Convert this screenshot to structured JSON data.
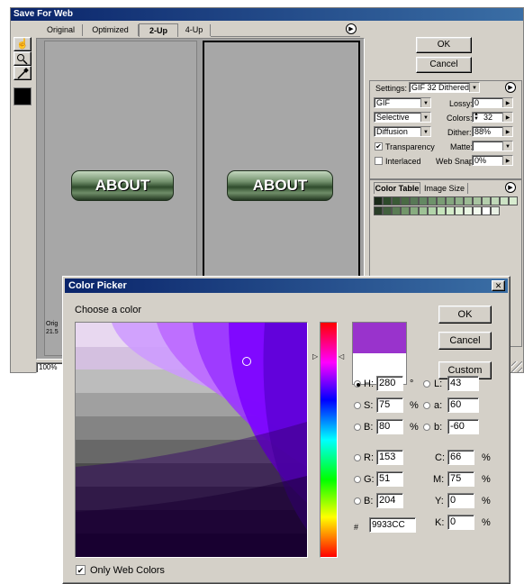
{
  "save_for_web": {
    "title": "Save For Web",
    "tabs": [
      "Original",
      "Optimized",
      "2-Up",
      "4-Up"
    ],
    "buttons": {
      "ok": "OK",
      "cancel": "Cancel"
    },
    "preview_text": "ABOUT",
    "info_line1": "Orig",
    "info_line2": "21.5",
    "zoom": "100%",
    "settings": {
      "label": "Settings:",
      "preset": "GIF 32 Dithered",
      "format": "GIF",
      "reduction": "Selective",
      "dither_algo": "Diffusion",
      "lossy_label": "Lossy:",
      "lossy": "0",
      "colors_label": "Colors:",
      "colors": "32",
      "dither_label": "Dither:",
      "dither": "88%",
      "matte_label": "Matte:",
      "transparency_label": "Transparency",
      "transparency_checked": true,
      "interlaced_label": "Interlaced",
      "interlaced_checked": false,
      "websnap_label": "Web Snap:",
      "websnap": "0%"
    },
    "panel_tabs": [
      "Color Table",
      "Image Size"
    ],
    "color_table": [
      "#1a2a18",
      "#2d4a2a",
      "#3a5a36",
      "#4a6a44",
      "#587856",
      "#648862",
      "#6e926a",
      "#7a9c74",
      "#84a67e",
      "#90b08a",
      "#9cba94",
      "#a8c4a0",
      "#b4ceac",
      "#c0d8b8",
      "#cce2c4",
      "#d8ecd0",
      "#2a3e28",
      "#42603e",
      "#5a7c54",
      "#72966a",
      "#88ac80",
      "#9ec296",
      "#b2d4aa",
      "#c6e4bc",
      "#d4ecca",
      "#e0f2d8",
      "#eaf6e4",
      "#f2faee",
      "#ffffff",
      "#e8f0e4"
    ]
  },
  "color_picker": {
    "title": "Color Picker",
    "prompt": "Choose a color",
    "buttons": {
      "ok": "OK",
      "cancel": "Cancel",
      "custom": "Custom"
    },
    "colors": {
      "new": "#9933cc",
      "original": "#ffffff"
    },
    "hsb": {
      "h_label": "H:",
      "h": "280",
      "h_unit": "°",
      "s_label": "S:",
      "s": "75",
      "s_unit": "%",
      "b_label": "B:",
      "b": "80",
      "b_unit": "%"
    },
    "lab": {
      "l_label": "L:",
      "l": "43",
      "a_label": "a:",
      "a": "60",
      "b_label": "b:",
      "b": "-60"
    },
    "rgb": {
      "r_label": "R:",
      "r": "153",
      "g_label": "G:",
      "g": "51",
      "b_label": "B:",
      "b": "204"
    },
    "cmyk": {
      "c_label": "C:",
      "c": "66",
      "m_label": "M:",
      "m": "75",
      "y_label": "Y:",
      "y": "0",
      "k_label": "K:",
      "k": "0",
      "unit": "%"
    },
    "hex_label": "#",
    "hex": "9933CC",
    "only_web_colors_label": "Only Web Colors",
    "only_web_colors_checked": true,
    "close_glyph": "✕"
  }
}
